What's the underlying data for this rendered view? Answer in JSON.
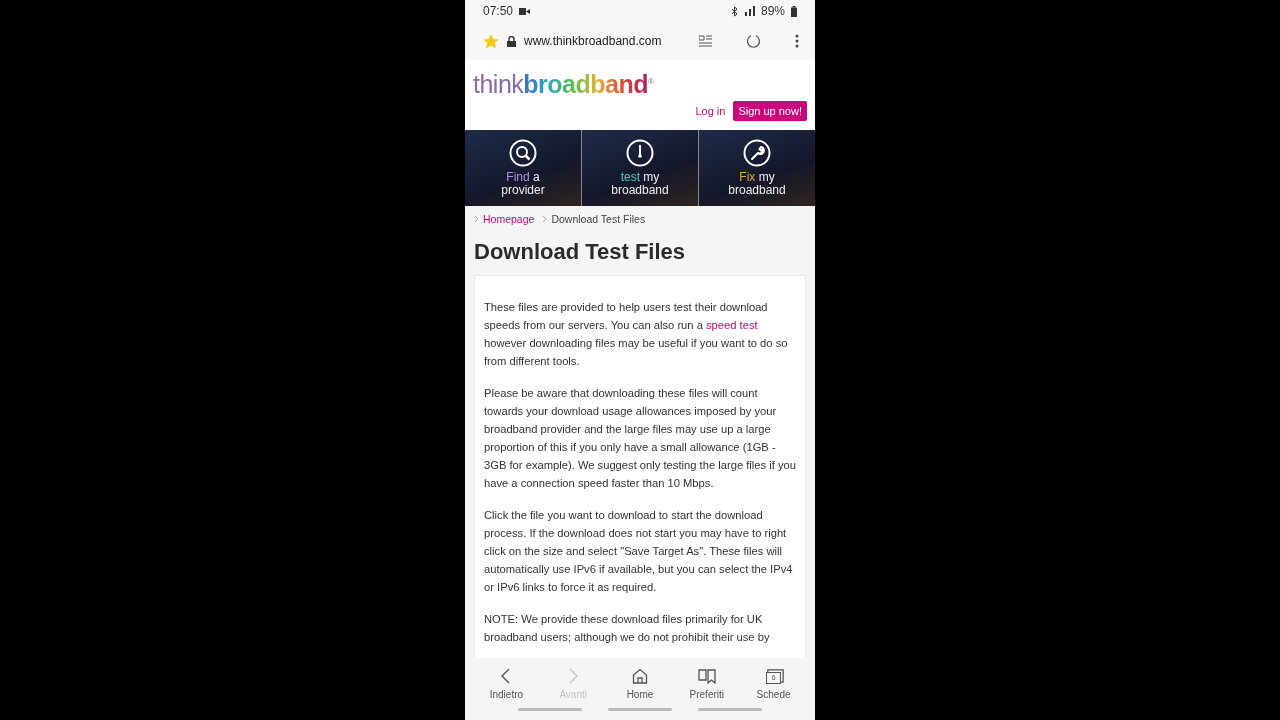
{
  "status_bar": {
    "time": "07:50",
    "battery": "89%"
  },
  "browser": {
    "url": "www.thinkbroadband.com",
    "bookmarked": true
  },
  "site": {
    "logo": {
      "light": "think",
      "bold": "broadband",
      "mark": "®"
    },
    "login": "Log in",
    "signup": "Sign up now!"
  },
  "tiles": [
    {
      "kind": "search",
      "accent": "Find",
      "rest": "a",
      "line2": "provider",
      "color": "#b590e6"
    },
    {
      "kind": "gauge",
      "accent": "test",
      "rest": "my",
      "line2": "broadband",
      "color": "#3fd6b0"
    },
    {
      "kind": "wrench",
      "accent": "Fix",
      "rest": "my",
      "line2": "broadband",
      "color": "#e6a53c"
    }
  ],
  "breadcrumb": [
    {
      "label": "Homepage",
      "kind": "link"
    },
    {
      "label": "Download Test Files",
      "kind": "current"
    }
  ],
  "title": "Download Test Files",
  "paragraphs": [
    [
      {
        "text": "These files are provided to help users test their download speeds from our servers. You can also run a "
      },
      {
        "text": "speed test",
        "kind": "link"
      },
      {
        "text": " however downloading files may be useful if you want to do so from different tools."
      }
    ],
    [
      {
        "text": "Please be aware that downloading these files will count towards your download usage allowances imposed by your broadband provider and the large files may use up a large proportion of this if you only have a small allowance (1GB - 3GB for example). We suggest only testing the large files if you have a connection speed faster than 10 Mbps."
      }
    ],
    [
      {
        "text": "Click the file you want to download to start the download process. If the download does not start you may have to right click on the size and select \"Save Target As\". These files will automatically use IPv6 if available, but you can select the IPv4 or IPv6 links to force it as required."
      }
    ],
    [
      {
        "text": "NOTE: We provide these download files primarily for UK broadband users; although we do not prohibit their use by"
      }
    ]
  ],
  "toolbar": [
    {
      "kind": "back",
      "label": "Indietro",
      "disabled": false
    },
    {
      "kind": "forward",
      "label": "Avanti",
      "disabled": true
    },
    {
      "kind": "home",
      "label": "Home",
      "disabled": false
    },
    {
      "kind": "bookmarks",
      "label": "Preferiti",
      "disabled": false
    },
    {
      "kind": "tabs",
      "label": "Schede",
      "disabled": false,
      "count": "6"
    }
  ]
}
